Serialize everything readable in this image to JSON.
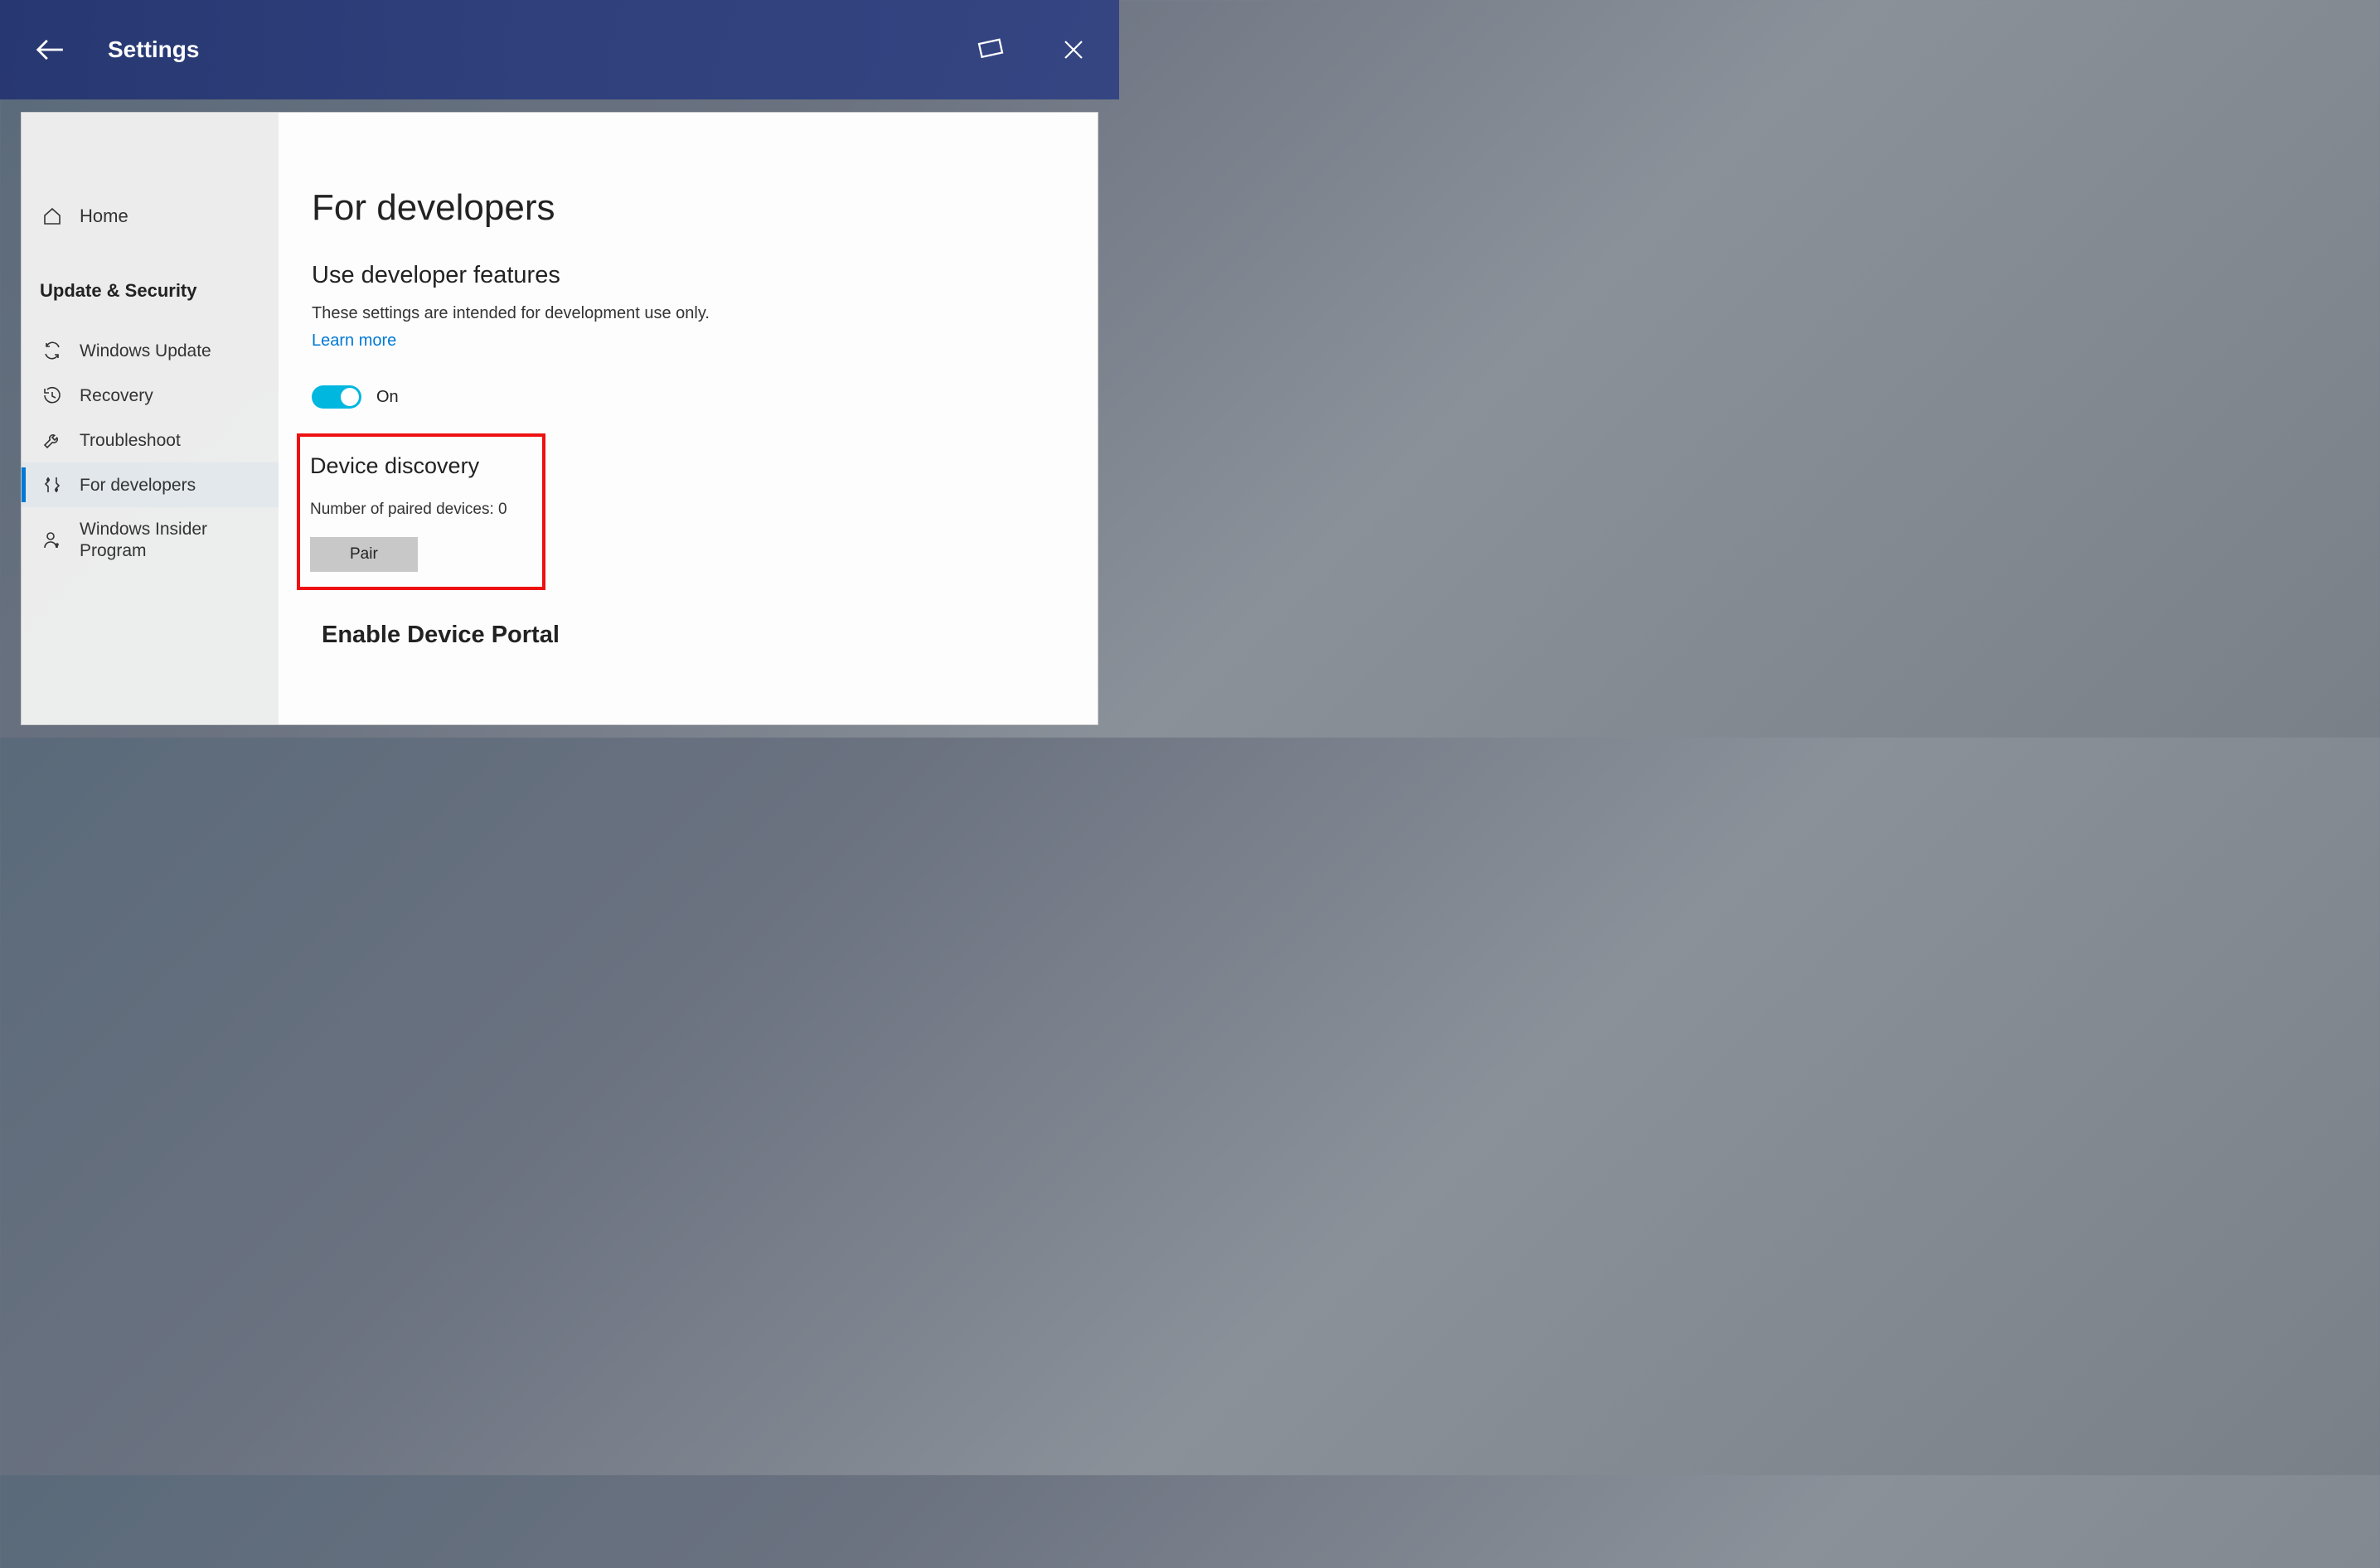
{
  "titlebar": {
    "title": "Settings"
  },
  "sidebar": {
    "home": "Home",
    "category": "Update & Security",
    "items": [
      {
        "label": "Windows Update"
      },
      {
        "label": "Recovery"
      },
      {
        "label": "Troubleshoot"
      },
      {
        "label": "For developers"
      },
      {
        "label": "Windows Insider Program"
      }
    ]
  },
  "content": {
    "heading": "For developers",
    "useDevFeatures": {
      "heading": "Use developer features",
      "description": "These settings are intended for development use only.",
      "learnMore": "Learn more",
      "toggleLabel": "On"
    },
    "deviceDiscovery": {
      "heading": "Device discovery",
      "pairedText": "Number of paired devices: 0",
      "pairButton": "Pair"
    },
    "enablePortal": {
      "heading": "Enable Device Portal"
    }
  }
}
